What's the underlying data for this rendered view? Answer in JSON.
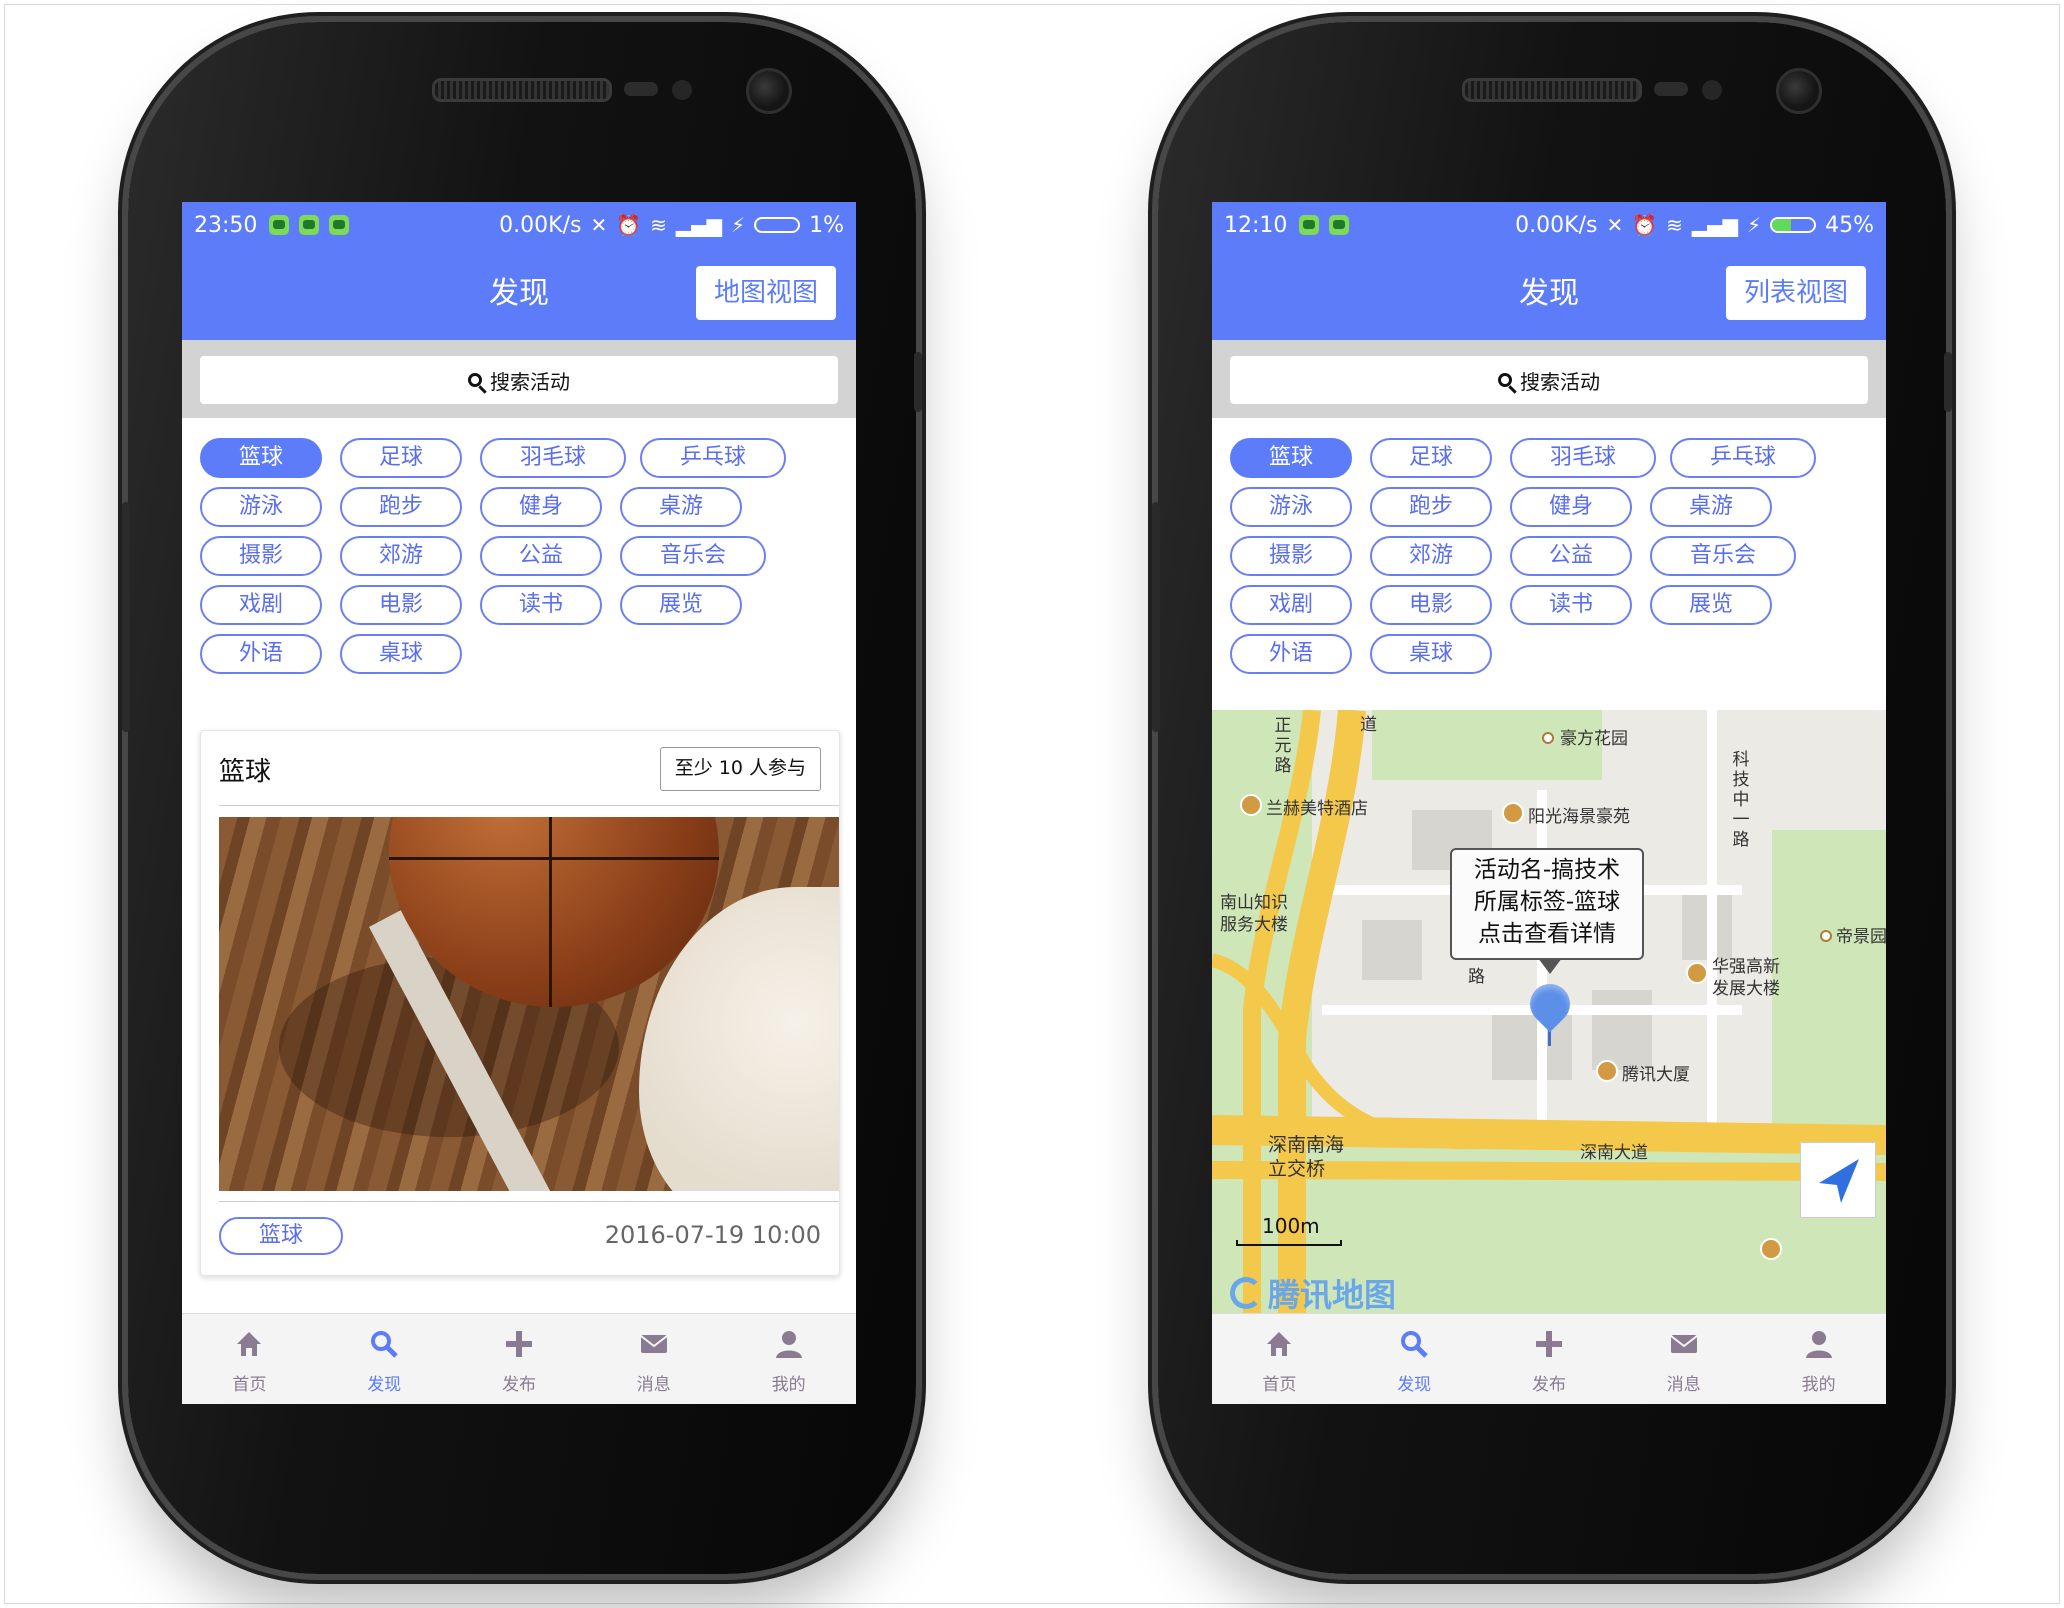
{
  "left_phone": {
    "status": {
      "time": "23:50",
      "net_speed": "0.00K/s",
      "battery": "1%",
      "battery_level": 0.01
    },
    "appbar": {
      "title": "发现",
      "view_button": "地图视图"
    },
    "search": {
      "placeholder": "搜索活动"
    },
    "tags": [
      "篮球",
      "足球",
      "羽毛球",
      "乒乓球",
      "游泳",
      "跑步",
      "健身",
      "桌游",
      "摄影",
      "郊游",
      "公益",
      "音乐会",
      "戏剧",
      "电影",
      "读书",
      "展览",
      "外语",
      "桌球"
    ],
    "selected_tag": "篮球",
    "card": {
      "title": "篮球",
      "badge": "至少 10 人参与",
      "tag": "篮球",
      "date": "2016-07-19 10:00"
    }
  },
  "right_phone": {
    "status": {
      "time": "12:10",
      "net_speed": "0.00K/s",
      "battery": "45%",
      "battery_level": 0.45
    },
    "appbar": {
      "title": "发现",
      "view_button": "列表视图"
    },
    "search": {
      "placeholder": "搜索活动"
    },
    "tags": [
      "篮球",
      "足球",
      "羽毛球",
      "乒乓球",
      "游泳",
      "跑步",
      "健身",
      "桌游",
      "摄影",
      "郊游",
      "公益",
      "音乐会",
      "戏剧",
      "电影",
      "读书",
      "展览",
      "外语",
      "桌球"
    ],
    "selected_tag": "篮球",
    "map": {
      "callout": {
        "line1": "活动名-搞技术",
        "line2": "所属标签-篮球",
        "line3": "点击查看详情"
      },
      "labels": {
        "haofang": "豪方花园",
        "lanhe": "兰赫美特酒店",
        "yangguang": "阳光海景豪苑",
        "nanshan_1": "南山知识",
        "nanshan_2": "服务大楼",
        "dijing": "帝景园",
        "huaqiang_1": "华强高新",
        "huaqiang_2": "发展大楼",
        "tencent": "腾讯大厦",
        "shennan_ave": "深南大道",
        "interchange_1": "深南南海",
        "interchange_2": "立交桥",
        "road_small": "路",
        "kejizhonglu": "科技中一路",
        "zhengyuanlu": "正元路",
        "dao": "道"
      },
      "scale": "100m",
      "brand": "腾讯地图"
    }
  },
  "tabbar": {
    "items": [
      {
        "label": "首页",
        "icon": "home-icon"
      },
      {
        "label": "发现",
        "icon": "search-icon"
      },
      {
        "label": "发布",
        "icon": "plus-icon"
      },
      {
        "label": "消息",
        "icon": "mail-icon"
      },
      {
        "label": "我的",
        "icon": "user-icon"
      }
    ],
    "active_index": 1
  },
  "colors": {
    "accent": "#5c7cfa",
    "tab_inactive": "#8a7b93",
    "tag_border": "#6b7ff3"
  }
}
